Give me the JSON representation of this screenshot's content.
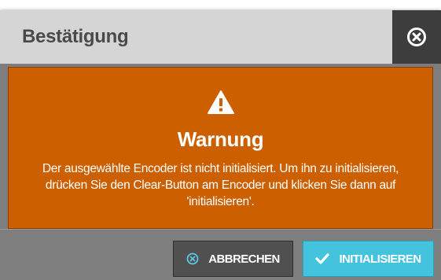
{
  "dialog": {
    "title": "Bestätigung",
    "close_icon": "close-circle-icon"
  },
  "warning": {
    "icon": "warning-triangle-icon",
    "heading": "Warnung",
    "message": "Der ausgewählte Encoder ist nicht initialisiert. Um ihn zu initialisieren, drücken Sie den Clear-Button am Encoder und klicken Sie dann auf 'initialisieren'."
  },
  "buttons": {
    "cancel_label": "ABBRECHEN",
    "cancel_icon": "cancel-circle-icon",
    "init_label": "INITIALISIEREN",
    "init_icon": "checkmark-icon"
  },
  "colors": {
    "warning_bg": "#cc6000",
    "header_bg": "#d5d5d5",
    "close_bg": "#3d3d3d",
    "cancel_bg": "#505050",
    "init_bg": "#43c3de"
  }
}
